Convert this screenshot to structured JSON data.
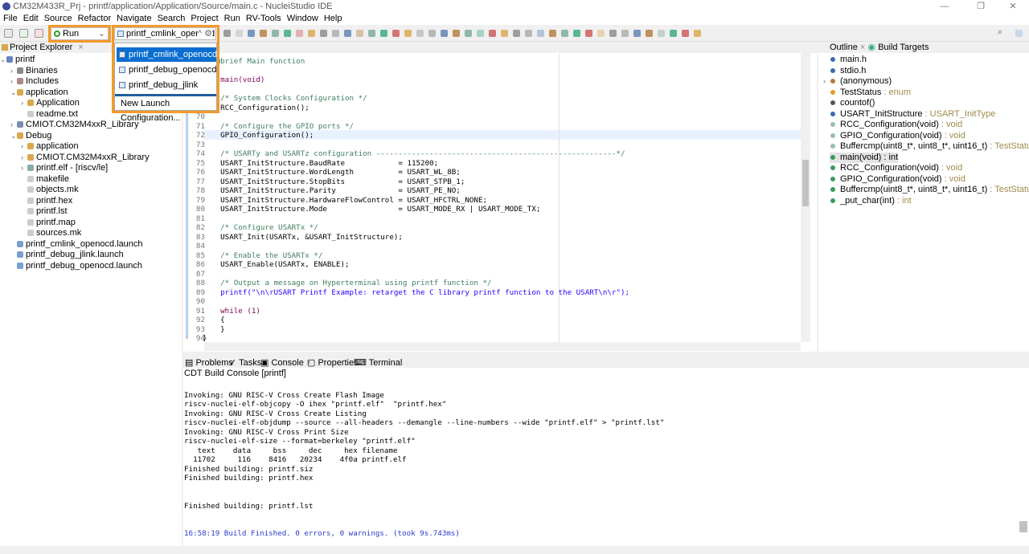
{
  "window": {
    "title": "CM32M433R_Prj - printf/application/Application/Source/main.c - NucleiStudio IDE"
  },
  "menu": [
    "File",
    "Edit",
    "Source",
    "Refactor",
    "Navigate",
    "Search",
    "Project",
    "Run",
    "RV-Tools",
    "Window",
    "Help"
  ],
  "toolbar": {
    "mode": "Run",
    "launch_config": "printf_cmlink_openocd"
  },
  "launch_dropdown": {
    "items": [
      "printf_cmlink_openocd",
      "printf_debug_openocd",
      "printf_debug_jlink"
    ],
    "selected": "printf_cmlink_openocd",
    "new_config": "New Launch Configuration..."
  },
  "colors": {
    "highlight": "#f39a2b",
    "selection": "#0a6ed1"
  },
  "project_explorer": {
    "title": "Project Explorer",
    "items": [
      {
        "label": "printf",
        "depth": 0,
        "expanded": true
      },
      {
        "label": "Binaries",
        "depth": 1,
        "expanded": false
      },
      {
        "label": "Includes",
        "depth": 1,
        "expanded": false
      },
      {
        "label": "application",
        "depth": 1,
        "expanded": true
      },
      {
        "label": "Application",
        "depth": 2,
        "expanded": false
      },
      {
        "label": "readme.txt",
        "depth": 2
      },
      {
        "label": "CMIOT.CM32M4xxR_Library",
        "depth": 1,
        "expanded": false
      },
      {
        "label": "Debug",
        "depth": 1,
        "expanded": true
      },
      {
        "label": "application",
        "depth": 2,
        "expanded": false
      },
      {
        "label": "CMIOT.CM32M4xxR_Library",
        "depth": 2,
        "expanded": false
      },
      {
        "label": "printf.elf - [riscv/le]",
        "depth": 2,
        "expanded": false
      },
      {
        "label": "makefile",
        "depth": 2
      },
      {
        "label": "objects.mk",
        "depth": 2
      },
      {
        "label": "printf.hex",
        "depth": 2
      },
      {
        "label": "printf.lst",
        "depth": 2
      },
      {
        "label": "printf.map",
        "depth": 2
      },
      {
        "label": "sources.mk",
        "depth": 2
      },
      {
        "label": "printf_cmlink_openocd.launch",
        "depth": 1
      },
      {
        "label": "printf_debug_jlink.launch",
        "depth": 1
      },
      {
        "label": "printf_debug_openocd.launch",
        "depth": 1
      }
    ]
  },
  "editor": {
    "lines": [
      {
        "n": "64",
        "code": " * @brief Main function"
      },
      {
        "n": "65",
        "code": ""
      },
      {
        "n": "66",
        "code": "int main(void)"
      },
      {
        "n": "67",
        "code": "{"
      },
      {
        "n": "68",
        "code": "    /* System Clocks Configuration */"
      },
      {
        "n": "69",
        "code": "    RCC_Configuration();"
      },
      {
        "n": "70",
        "code": ""
      },
      {
        "n": "71",
        "code": "    /* Configure the GPIO ports */"
      },
      {
        "n": "72",
        "code": "    GPIO_Configuration();"
      },
      {
        "n": "73",
        "code": ""
      },
      {
        "n": "74",
        "code": "    /* USARTy and USARTz configuration ------------------------------------------------------*/"
      },
      {
        "n": "75",
        "code": "    USART_InitStructure.BaudRate            = 115200;"
      },
      {
        "n": "76",
        "code": "    USART_InitStructure.WordLength          = USART_WL_8B;"
      },
      {
        "n": "77",
        "code": "    USART_InitStructure.StopBits            = USART_STPB_1;"
      },
      {
        "n": "78",
        "code": "    USART_InitStructure.Parity              = USART_PE_NO;"
      },
      {
        "n": "79",
        "code": "    USART_InitStructure.HardwareFlowControl = USART_HFCTRL_NONE;"
      },
      {
        "n": "80",
        "code": "    USART_InitStructure.Mode                = USART_MODE_RX | USART_MODE_TX;"
      },
      {
        "n": "81",
        "code": ""
      },
      {
        "n": "82",
        "code": "    /* Configure USARTx */"
      },
      {
        "n": "83",
        "code": "    USART_Init(USARTx, &USART_InitStructure);"
      },
      {
        "n": "84",
        "code": ""
      },
      {
        "n": "85",
        "code": "    /* Enable the USARTx */"
      },
      {
        "n": "86",
        "code": "    USART_Enable(USARTx, ENABLE);"
      },
      {
        "n": "87",
        "code": ""
      },
      {
        "n": "88",
        "code": "    /* Output a message on Hyperterminal using printf function */"
      },
      {
        "n": "89",
        "code": "    printf(\"\\n\\rUSART Printf Example: retarget the C library printf function to the USART\\n\\r\");"
      },
      {
        "n": "90",
        "code": ""
      },
      {
        "n": "91",
        "code": "    while (1)"
      },
      {
        "n": "92",
        "code": "    {"
      },
      {
        "n": "93",
        "code": "    }"
      },
      {
        "n": "94",
        "code": "}"
      }
    ]
  },
  "outline": {
    "tabs": [
      "Outline",
      "Build Targets"
    ],
    "items": [
      {
        "name": "main.h",
        "type": ""
      },
      {
        "name": "stdio.h",
        "type": ""
      },
      {
        "name": "(anonymous)",
        "type": ""
      },
      {
        "name": "TestStatus",
        "type": " : enum"
      },
      {
        "name": "countof()",
        "type": ""
      },
      {
        "name": "USART_InitStructure",
        "type": " : USART_InitType"
      },
      {
        "name": "RCC_Configuration(void)",
        "type": " : void"
      },
      {
        "name": "GPIO_Configuration(void)",
        "type": " : void"
      },
      {
        "name": "Buffercmp(uint8_t*, uint8_t*, uint16_t)",
        "type": " : TestStatus"
      },
      {
        "name": "main(void) : int",
        "type": ""
      },
      {
        "name": "RCC_Configuration(void)",
        "type": " : void"
      },
      {
        "name": "GPIO_Configuration(void)",
        "type": " : void"
      },
      {
        "name": "Buffercmp(uint8_t*, uint8_t*, uint16_t)",
        "type": " : TestStatus"
      },
      {
        "name": "_put_char(int)",
        "type": " : int"
      }
    ]
  },
  "console": {
    "tabs": [
      "Problems",
      "Tasks",
      "Console",
      "Properties",
      "Terminal"
    ],
    "title": "CDT Build Console [printf]",
    "lines": [
      "",
      "Invoking: GNU RISC-V Cross Create Flash Image",
      "riscv-nuclei-elf-objcopy -O ihex \"printf.elf\"  \"printf.hex\"",
      "Invoking: GNU RISC-V Cross Create Listing",
      "riscv-nuclei-elf-objdump --source --all-headers --demangle --line-numbers --wide \"printf.elf\" > \"printf.lst\"",
      "Invoking: GNU RISC-V Cross Print Size",
      "riscv-nuclei-elf-size --format=berkeley \"printf.elf\"",
      "   text    data     bss     dec     hex filename",
      "  11702     116    8416   20234    4f0a printf.elf",
      "Finished building: printf.siz",
      "Finished building: printf.hex",
      "",
      "",
      "Finished building: printf.lst",
      "",
      "",
      "16:58:19 Build Finished. 0 errors, 0 warnings. (took 9s.743ms)"
    ]
  }
}
